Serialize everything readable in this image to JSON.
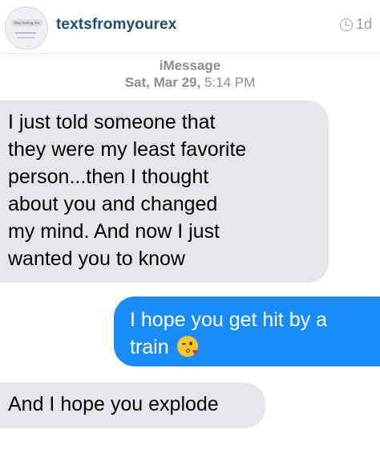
{
  "header": {
    "avatar_text": "Stop texting me",
    "handle": "textsfromyourex",
    "time": "1d"
  },
  "conversation": {
    "service": "iMessage",
    "date": "Sat, Mar 29,",
    "time": "5:14 PM",
    "messages": [
      {
        "sender": "them",
        "lines": [
          "I just told someone that",
          "they were my least favorite",
          "person...then I thought",
          "about you and changed",
          "my mind. And now I just",
          "wanted you to know"
        ]
      },
      {
        "sender": "me",
        "lines": [
          "I hope you get hit by a",
          "train"
        ],
        "emoji": "kissing-face-with-heart"
      },
      {
        "sender": "them",
        "lines": [
          "And I hope you explode"
        ]
      }
    ]
  },
  "colors": {
    "handle": "#1d4e76",
    "incoming_bubble": "#e5e5ea",
    "outgoing_bubble": "#1a8cf7",
    "meta_text": "#8e8e93"
  }
}
